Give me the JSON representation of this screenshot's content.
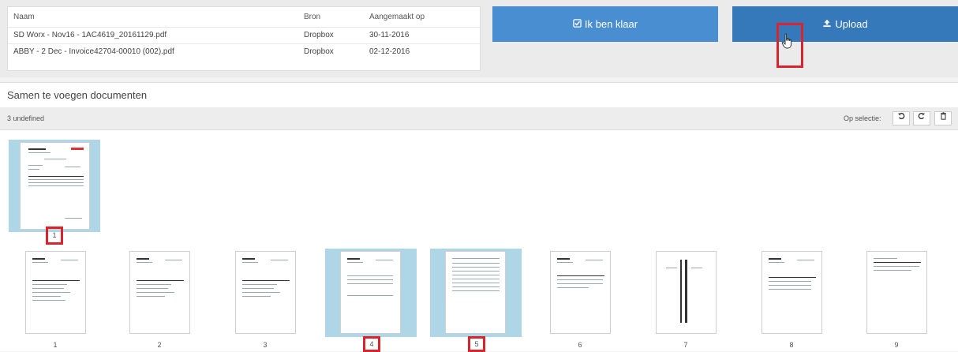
{
  "files": {
    "headers": {
      "name": "Naam",
      "source": "Bron",
      "created": "Aangemaakt op"
    },
    "rows": [
      {
        "name": "SD Worx - Nov16 - 1AC4619_20161129.pdf",
        "source": "Dropbox",
        "created": "30-11-2016"
      },
      {
        "name": "ABBY - 2 Dec - Invoice42704-00010 (002).pdf",
        "source": "Dropbox",
        "created": "02-12-2016"
      }
    ]
  },
  "buttons": {
    "done_label": "Ik ben klaar",
    "done_icon": "check-square-icon",
    "upload_label": "Upload",
    "upload_icon": "upload-icon"
  },
  "section": {
    "title": "Samen te voegen documenten"
  },
  "toolbar": {
    "count_text": "3 undefined",
    "selection_label": "Op selectie:",
    "actions": [
      "rotate-left-icon",
      "rotate-right-icon",
      "trash-icon"
    ]
  },
  "merged": {
    "page_label": "1"
  },
  "pages": [
    {
      "label": "1",
      "selected": false
    },
    {
      "label": "2",
      "selected": false
    },
    {
      "label": "3",
      "selected": false
    },
    {
      "label": "4",
      "selected": true
    },
    {
      "label": "5",
      "selected": true
    },
    {
      "label": "6",
      "selected": false
    },
    {
      "label": "7",
      "selected": false
    },
    {
      "label": "8",
      "selected": false
    },
    {
      "label": "9",
      "selected": false
    }
  ],
  "colors": {
    "done": "#4a8ed2",
    "upload": "#3579ba",
    "highlight": "#d9242e",
    "selected": "#afd6e6"
  }
}
